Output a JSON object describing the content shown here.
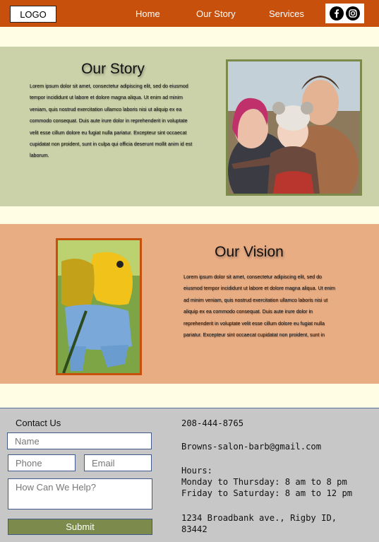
{
  "header": {
    "logo": "LOGO",
    "nav": [
      "Home",
      "Our Story",
      "Services"
    ],
    "social_icons": [
      "facebook-icon",
      "instagram-icon"
    ],
    "accent_color": "#c8500d"
  },
  "story": {
    "title": "Our Story",
    "text": "Lorem ipsum dolor sit amet, consectetur adipiscing elit, sed do eiusmod tempor incididunt ut labore et dolore magna aliqua. Ut enim ad minim veniam, quis nostrud exercitation ullamco laboris nisi ut aliquip ex ea commodo consequat. Duis aute irure dolor in reprehenderit in voluptate velit esse cillum dolore eu fugiat nulla pariatur. Excepteur sint occaecat cupidatat non proident, sunt in culpa qui officia deserunt mollit anim id est laborum.",
    "background": "#cbd2aa"
  },
  "vision": {
    "title": "Our Vision",
    "text": "Lorem ipsum dolor sit amet, consectetur adipiscing elit, sed do eiusmod tempor incididunt ut labore et dolore magna aliqua. Ut enim ad minim veniam, quis nostrud exercitation ullamco laboris nisi ut aliquip ex ea commodo consequat. Duis aute irure dolor in reprehenderit in voluptate velit esse cillum dolore eu fugiat nulla pariatur. Excepteur sint occaecat cupidatat non proident, sunt in",
    "background": "#e9ad84"
  },
  "footer": {
    "contact_title": "Contact Us",
    "name_placeholder": "Name",
    "phone_placeholder": "Phone",
    "email_placeholder": "Email",
    "help_placeholder": "How Can We Help?",
    "submit_label": "Submit",
    "phone": "208-444-8765",
    "email": "Browns-salon-barb@gmail.com",
    "hours_label": "Hours:",
    "hours_weekday": "Monday to Thursday: 8 am to 8 pm",
    "hours_weekend": "Friday to Saturday: 8 am to 12 pm",
    "address_line1": "1234 Broadbank ave., Rigby ID,",
    "address_line2": "83442"
  }
}
